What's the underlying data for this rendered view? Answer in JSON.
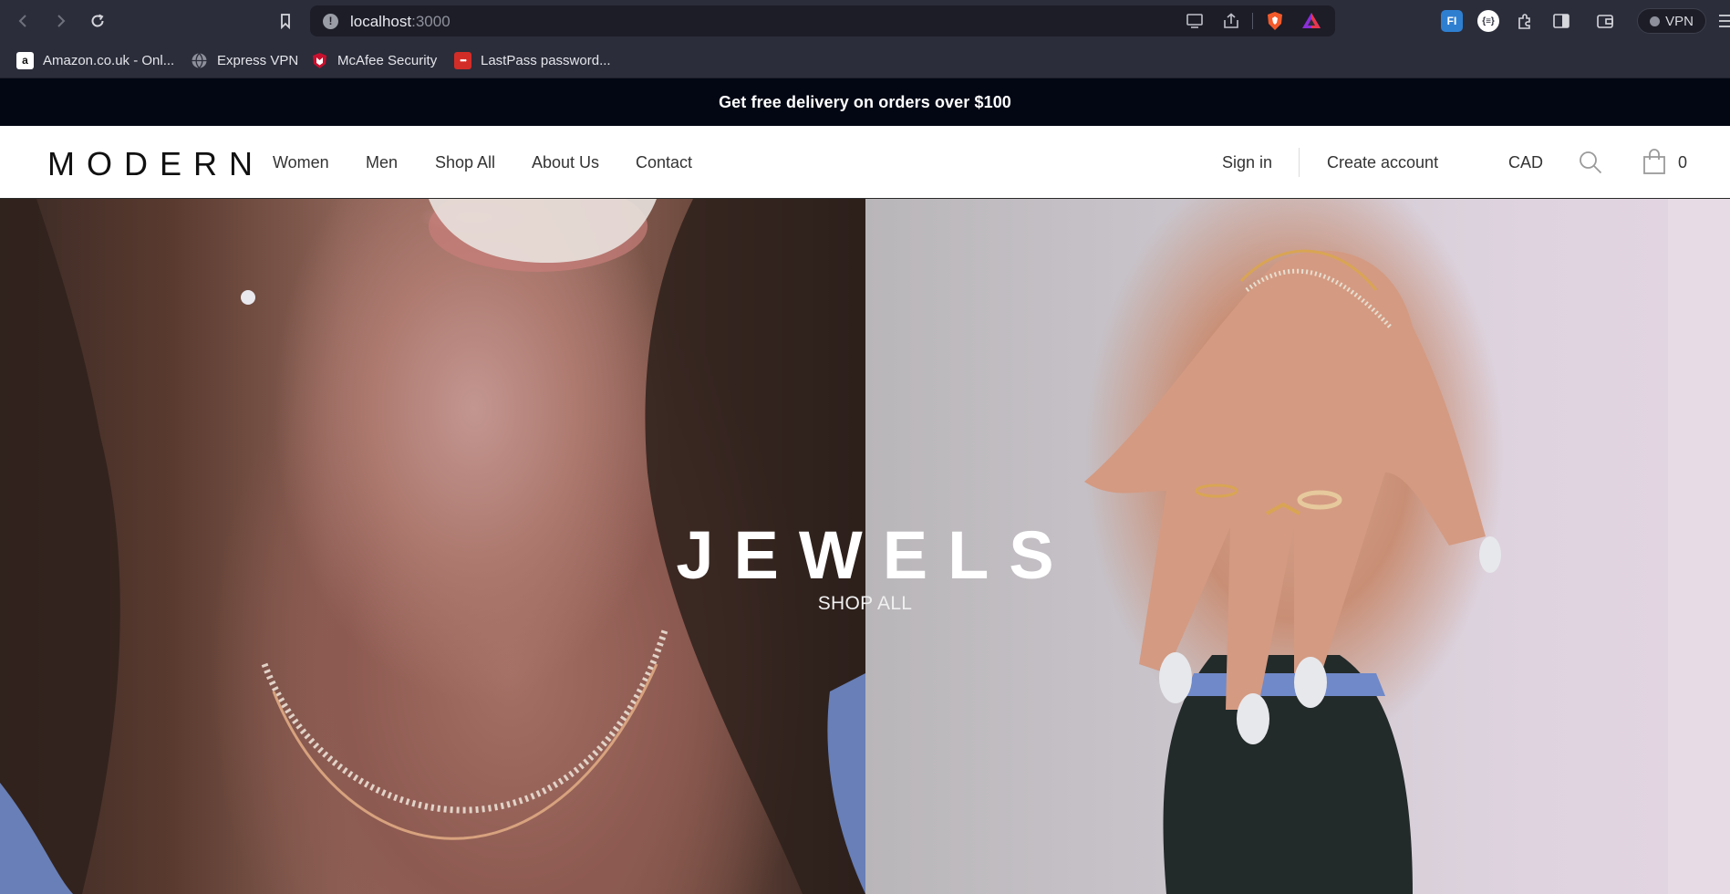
{
  "browser": {
    "url_host": "localhost",
    "url_port": ":3000",
    "vpn_label": "VPN",
    "extensions": [
      {
        "name": "fi-extension",
        "label": "FI"
      },
      {
        "name": "json-extension",
        "label": "{≡}"
      }
    ],
    "bookmarks": [
      {
        "label": "Amazon.co.uk - Onl...",
        "icon": "amazon-icon"
      },
      {
        "label": "Express VPN",
        "icon": "globe-icon"
      },
      {
        "label": "McAfee Security",
        "icon": "mcafee-icon"
      },
      {
        "label": "LastPass password...",
        "icon": "lastpass-icon"
      }
    ]
  },
  "promo": {
    "text": "Get free delivery on orders over $100"
  },
  "header": {
    "logo": "MODERN",
    "nav": [
      "Women",
      "Men",
      "Shop All",
      "About Us",
      "Contact"
    ],
    "sign_in": "Sign in",
    "create_account": "Create account",
    "currency": "CAD",
    "cart_count": "0"
  },
  "hero": {
    "title": "JEWELS",
    "cta": "SHOP ALL"
  },
  "colors": {
    "promo_bg": "#030714",
    "browser_chrome": "#2b2d3a",
    "address_bar": "#1c1d27"
  }
}
